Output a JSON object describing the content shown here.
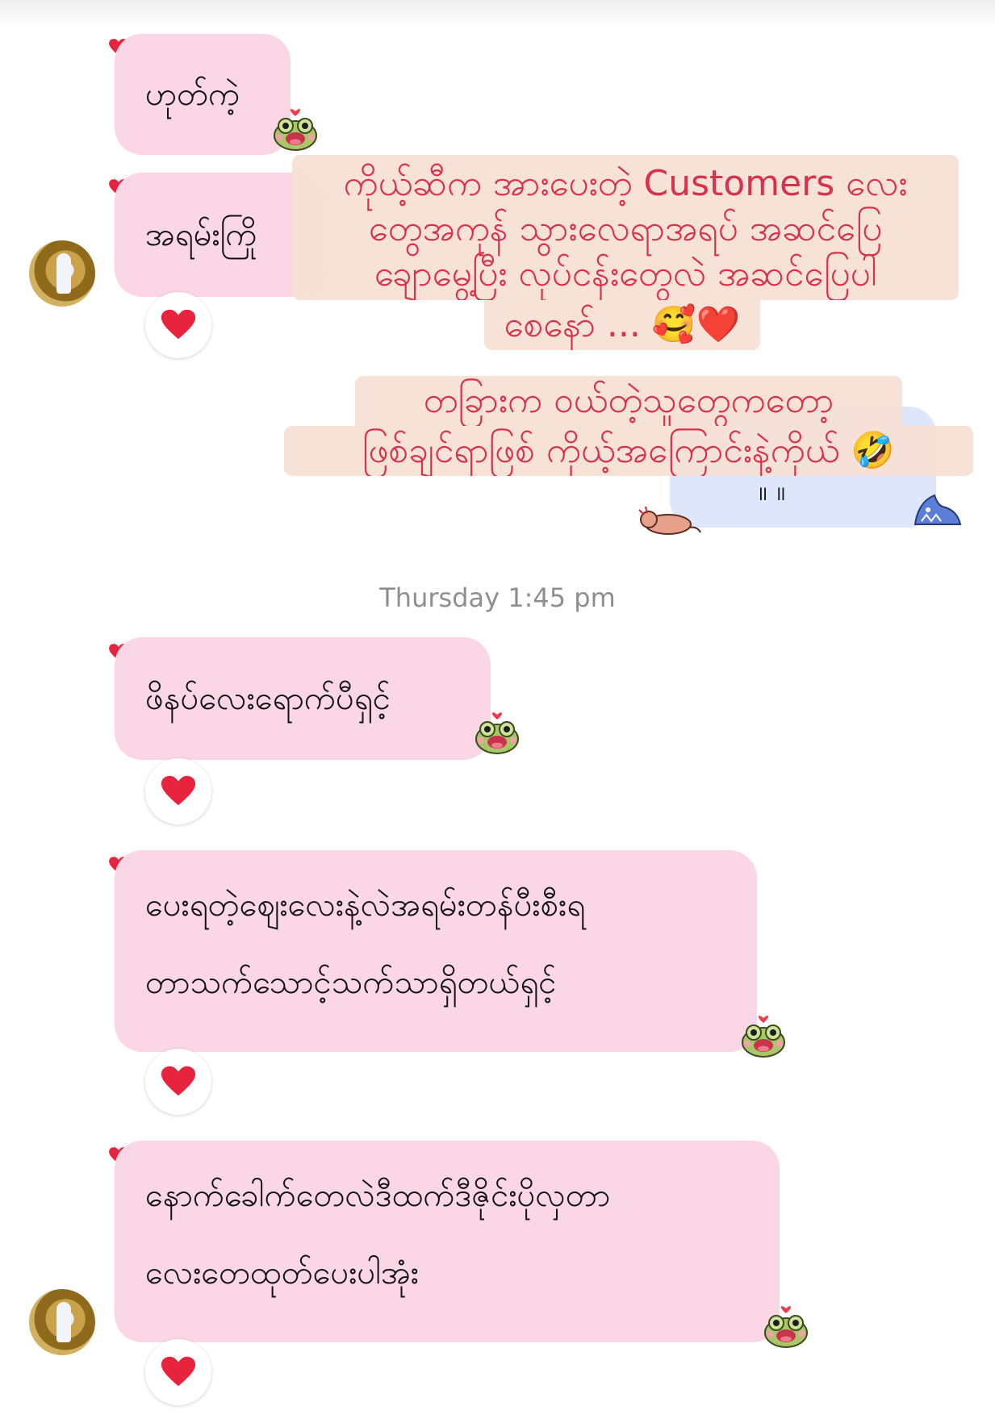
{
  "colors": {
    "incoming_bubble": "#fbd6e4",
    "outgoing_bubble": "#dde6fa",
    "overlay_background": "#f6e0d4",
    "overlay_text": "#d8324a",
    "timestamp_text": "#8e8e8e",
    "heart": "#e8233d"
  },
  "icons": {
    "reaction": "red-heart-icon",
    "liked_badge": "heart-badge-icon",
    "sticker": "frog-sticker-icon",
    "outgoing_sticker_left": "pig-sticker-icon",
    "outgoing_sticker_right": "shark-sticker-icon",
    "overlay_emoji_1": "smiling-face-with-hearts-emoji",
    "overlay_emoji_2": "red-heart-emoji",
    "overlay_emoji_3": "rolling-on-floor-laughing-emoji"
  },
  "messages": [
    {
      "text": "ဟုတ်ကဲ့"
    },
    {
      "text": "အရမ်းကြို"
    },
    {
      "line1": "ဖိနပ်လေးရောက်ပီရှင့်"
    },
    {
      "line1": "ပေးရတဲ့ဈေးလေးနဲ့လဲအရမ်းတန်ပီးစီးရ",
      "line2": "တာသက်သောင့်သက်သာရှိတယ်ရှင့်"
    },
    {
      "line1": "နောက်ခေါက်တေလဲဒီထက်ဒီဇိုင်းပိုလှတာ",
      "line2": "လေးတေထုတ်ပေးပါအုံး"
    }
  ],
  "outgoing": {
    "partial_text": "။ ။"
  },
  "timestamp": "Thursday 1:45 pm",
  "overlays": {
    "first": {
      "line1": "ကိုယ့်ဆီက အားပေးတဲ့ Customers လေး",
      "line2": "တွေအကုန် သွားလေရာအရပ် အဆင်ပြေ",
      "line3": "ချောမွေ့ပြီး လုပ်ငန်းတွေလဲ အဆင်ပြေပါ",
      "line4": "စေနော် ... 🥰❤️"
    },
    "second": {
      "line1": "တခြားက ဝယ်တဲ့သူတွေကတော့",
      "line2": "ဖြစ်ချင်ရာဖြစ် ကိုယ့်အကြောင်းနဲ့ကိုယ် 🤣"
    }
  }
}
